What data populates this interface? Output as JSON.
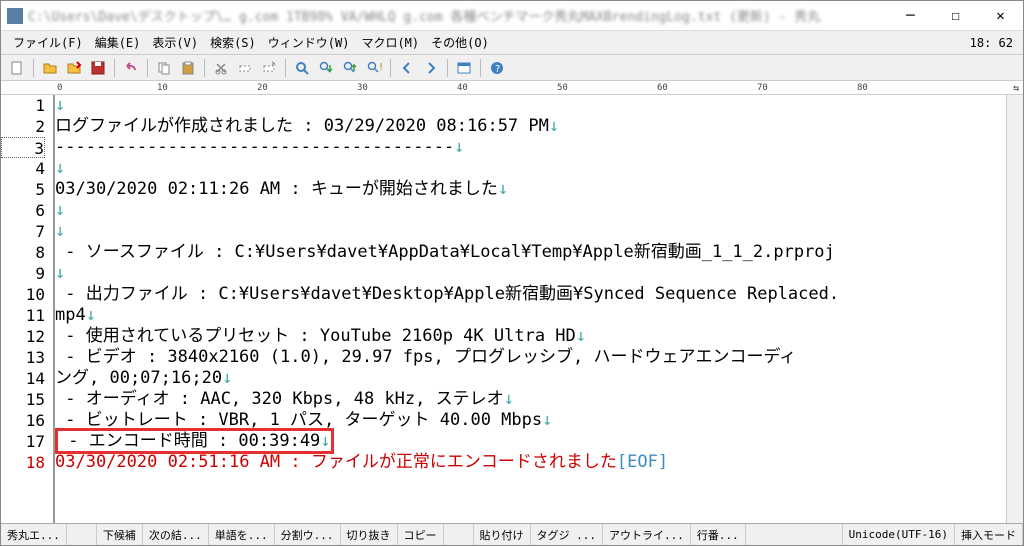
{
  "window": {
    "title": "C:\\Users\\Dave\\デスクトップ\\… g.com 1TB98% VA/WHLQ g.com 各種ベンチマーク秀丸MAXBrendingLog.txt (更新) - 秀丸"
  },
  "menubar": {
    "file": "ファイル(F)",
    "edit": "編集(E)",
    "view": "表示(V)",
    "search": "検索(S)",
    "window": "ウィンドウ(W)",
    "macro": "マクロ(M)",
    "other": "その他(O)",
    "clock": "18: 62"
  },
  "ruler": {
    "ticks": [
      "0",
      "10",
      "20",
      "30",
      "40",
      "50",
      "60",
      "70",
      "80"
    ]
  },
  "lines": [
    {
      "n": 1,
      "text": "",
      "nl": "↓"
    },
    {
      "n": 2,
      "text": "ログファイルが作成されました : 03/29/2020 08:16:57 PM",
      "nl": "↓"
    },
    {
      "n": 3,
      "text": "---------------------------------------",
      "nl": "↓"
    },
    {
      "n": 4,
      "text": "",
      "nl": "↓"
    },
    {
      "n": 5,
      "text": "03/30/2020 02:11:26 AM : キューが開始されました",
      "nl": "↓"
    },
    {
      "n": 6,
      "text": "",
      "nl": "↓"
    },
    {
      "n": 7,
      "text": "",
      "nl": "↓"
    },
    {
      "n": 8,
      "text": " - ソースファイル : C:¥Users¥davet¥AppData¥Local¥Temp¥Apple新宿動画_1_1_2.prproj",
      "nl": ""
    },
    {
      "n": 9,
      "text": "",
      "nl": "↓"
    },
    {
      "n": 10,
      "text": " - 出力ファイル : C:¥Users¥davet¥Desktop¥Apple新宿動画¥Synced Sequence Replaced.",
      "nl": ""
    },
    {
      "n": 11,
      "text": "mp4",
      "nl": "↓"
    },
    {
      "n": 12,
      "text": " - 使用されているプリセット : YouTube 2160p 4K Ultra HD",
      "nl": "↓"
    },
    {
      "n": 13,
      "text": " - ビデオ : 3840x2160 (1.0), 29.97 fps, プログレッシブ, ハードウェアエンコーディ",
      "nl": ""
    },
    {
      "n": 14,
      "text": "ング, 00;07;16;20",
      "nl": "↓"
    },
    {
      "n": 15,
      "text": " - オーディオ : AAC, 320 Kbps, 48 kHz, ステレオ",
      "nl": "↓"
    },
    {
      "n": 16,
      "text": " - ビットレート : VBR, 1 パス, ターゲット 40.00 Mbps",
      "nl": "↓"
    },
    {
      "n": 17,
      "text": " - エンコード時間 : 00:39:49",
      "nl": "↓",
      "boxed": true
    },
    {
      "n": 18,
      "text": "03/30/2020 02:51:16 AM : ファイルが正常にエンコードされました",
      "eof": "[EOF]",
      "last": true
    }
  ],
  "status": {
    "hidemaru": "秀丸エ...",
    "shimo": "下候補",
    "tsugi": "次の結...",
    "tango": "単語を...",
    "bunkatsu": "分割ウ...",
    "kirinuki": "切り抜き",
    "copy": "コピー",
    "paste": "貼り付け",
    "tag": "タグジ ...",
    "outline": "アウトライ...",
    "gyoban": "行番...",
    "encoding": "Unicode(UTF-16)",
    "mode": "挿入モード"
  }
}
